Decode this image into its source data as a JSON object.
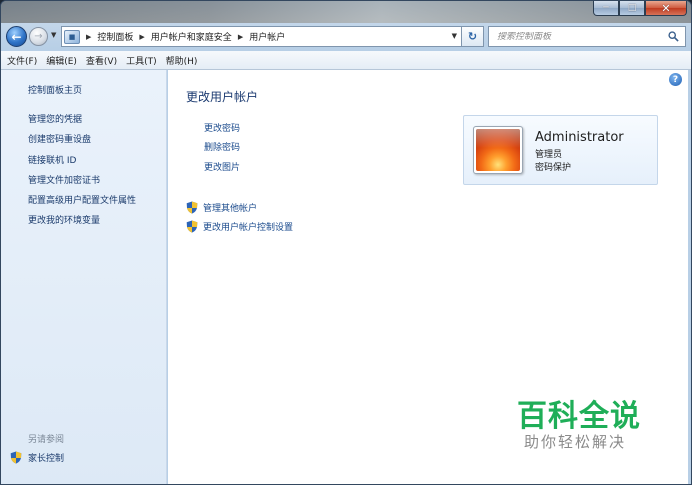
{
  "colors": {
    "link": "#1a4a8c",
    "title": "#1c3b71",
    "sidebar_bg": "#e3eef9",
    "watermark_green": "#1fae58"
  },
  "window_controls": {
    "minimize_icon": "minimize-icon",
    "maximize_icon": "maximize-icon",
    "close_icon": "close-icon"
  },
  "nav": {
    "back_icon": "back-arrow-icon",
    "forward_icon": "forward-arrow-icon",
    "breadcrumbs": [
      "控制面板",
      "用户帐户和家庭安全",
      "用户帐户"
    ],
    "search_placeholder": "搜索控制面板"
  },
  "menubar": {
    "items": [
      "文件(F)",
      "编辑(E)",
      "查看(V)",
      "工具(T)",
      "帮助(H)"
    ]
  },
  "sidebar": {
    "home": "控制面板主页",
    "links": [
      "管理您的凭据",
      "创建密码重设盘",
      "链接联机 ID",
      "管理文件加密证书",
      "配置高级用户配置文件属性",
      "更改我的环境变量"
    ],
    "see_also_label": "另请参阅",
    "see_also_links": [
      "家长控制"
    ]
  },
  "main": {
    "title": "更改用户帐户",
    "tasks": [
      "更改密码",
      "删除密码",
      "更改图片"
    ],
    "admin_tasks": [
      "管理其他帐户",
      "更改用户帐户控制设置"
    ]
  },
  "account": {
    "name": "Administrator",
    "role": "管理员",
    "status": "密码保护"
  },
  "watermark": {
    "title": "百科全说",
    "subtitle": "助你轻松解决"
  }
}
